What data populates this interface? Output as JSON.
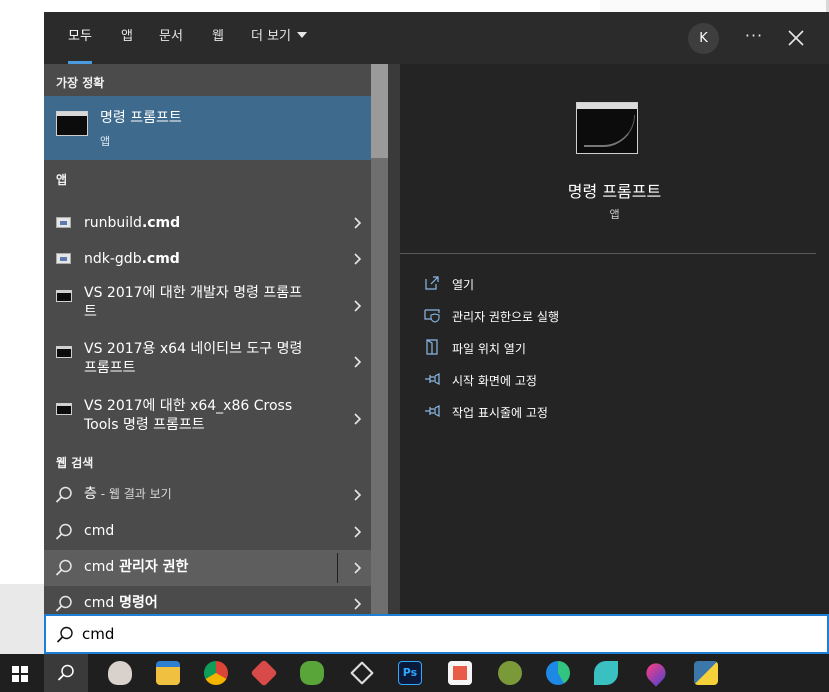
{
  "tabs": [
    {
      "label": "모두",
      "active": true
    },
    {
      "label": "앱"
    },
    {
      "label": "문서"
    },
    {
      "label": "웹"
    },
    {
      "label": "더 보기"
    }
  ],
  "account": {
    "initial": "K"
  },
  "more_label": "···",
  "sections": {
    "best_match": "가장 정확",
    "apps": "앱",
    "web": "웹 검색"
  },
  "best_match": {
    "title": "명령 프롬프트",
    "subtitle": "앱"
  },
  "apps": [
    {
      "prefix": "runbuild",
      "bold": ".cmd"
    },
    {
      "prefix": "ndk-gdb",
      "bold": ".cmd"
    },
    {
      "line1": "VS 2017에 대한 개발자 명령 프롬프",
      "line2": "트"
    },
    {
      "line1": "VS 2017용 x64 네이티브 도구 명령",
      "line2": "프롬프트"
    },
    {
      "line1": "VS 2017에 대한 x64_x86 Cross",
      "line2": "Tools 명령 프롬프트"
    }
  ],
  "web": [
    {
      "term": "층",
      "suffix": " - 웹 결과 보기"
    },
    {
      "term": "cmd",
      "suffix": ""
    },
    {
      "term": "cmd",
      "bold": " 관리자 권한"
    },
    {
      "term": "cmd",
      "bold": " 명령어"
    }
  ],
  "preview": {
    "title": "명령 프롬프트",
    "subtitle": "앱",
    "actions": [
      {
        "label": "열기"
      },
      {
        "label": "관리자 권한으로 실행"
      },
      {
        "label": "파일 위치 열기"
      },
      {
        "label": "시작 화면에 고정"
      },
      {
        "label": "작업 표시줄에 고정"
      }
    ]
  },
  "search": {
    "value": "cmd"
  },
  "taskbar": {
    "icons": [
      "paint-icon",
      "file-explorer-icon",
      "chrome-icon",
      "app-icon",
      "spring-icon",
      "unity-icon",
      "photoshop-icon",
      "photo-icon",
      "app2-icon",
      "edge-icon",
      "app3-icon",
      "drop-icon",
      "python-icon"
    ],
    "colors": {
      "accent": "#1e7fd6",
      "selected": "#3e6a8d"
    }
  }
}
